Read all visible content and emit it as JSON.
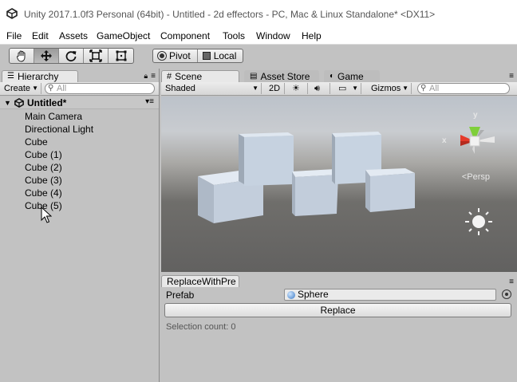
{
  "window": {
    "title": "Unity 2017.1.0f3 Personal (64bit) - Untitled - 2d effectors - PC, Mac & Linux Standalone* <DX11>"
  },
  "menu": [
    "File",
    "Edit",
    "Assets",
    "GameObject",
    "Component",
    "Tools",
    "Window",
    "Help"
  ],
  "toolbar": {
    "tools": [
      "hand-icon",
      "move-icon",
      "rotate-icon",
      "scale-icon",
      "rect-tool-icon"
    ],
    "active_tool": "move-icon",
    "pivot_label": "Pivot",
    "local_label": "Local"
  },
  "hierarchy": {
    "tab_label": "Hierarchy",
    "create_label": "Create",
    "search_placeholder": "All",
    "scene_name": "Untitled*",
    "items": [
      "Main Camera",
      "Directional Light",
      "Cube",
      "Cube (1)",
      "Cube (2)",
      "Cube (3)",
      "Cube (4)",
      "Cube (5)"
    ]
  },
  "scene_tabs": {
    "scene": "Scene",
    "asset_store": "Asset Store",
    "game": "Game"
  },
  "scene_toolbar": {
    "shading": "Shaded",
    "mode_2d": "2D",
    "gizmos": "Gizmos",
    "search_placeholder": "All"
  },
  "scene_view": {
    "gizmo_y": "y",
    "gizmo_x": "x",
    "projection": "Persp",
    "colors": {
      "gizmo_x": "#e53a2a",
      "gizmo_y": "#7fcf3a",
      "cube_face": "#c9d6e6"
    }
  },
  "replace_window": {
    "tab_label": "ReplaceWithPre",
    "prefab_label": "Prefab",
    "prefab_value": "Sphere",
    "replace_button": "Replace",
    "selection_count": "Selection count: 0"
  }
}
